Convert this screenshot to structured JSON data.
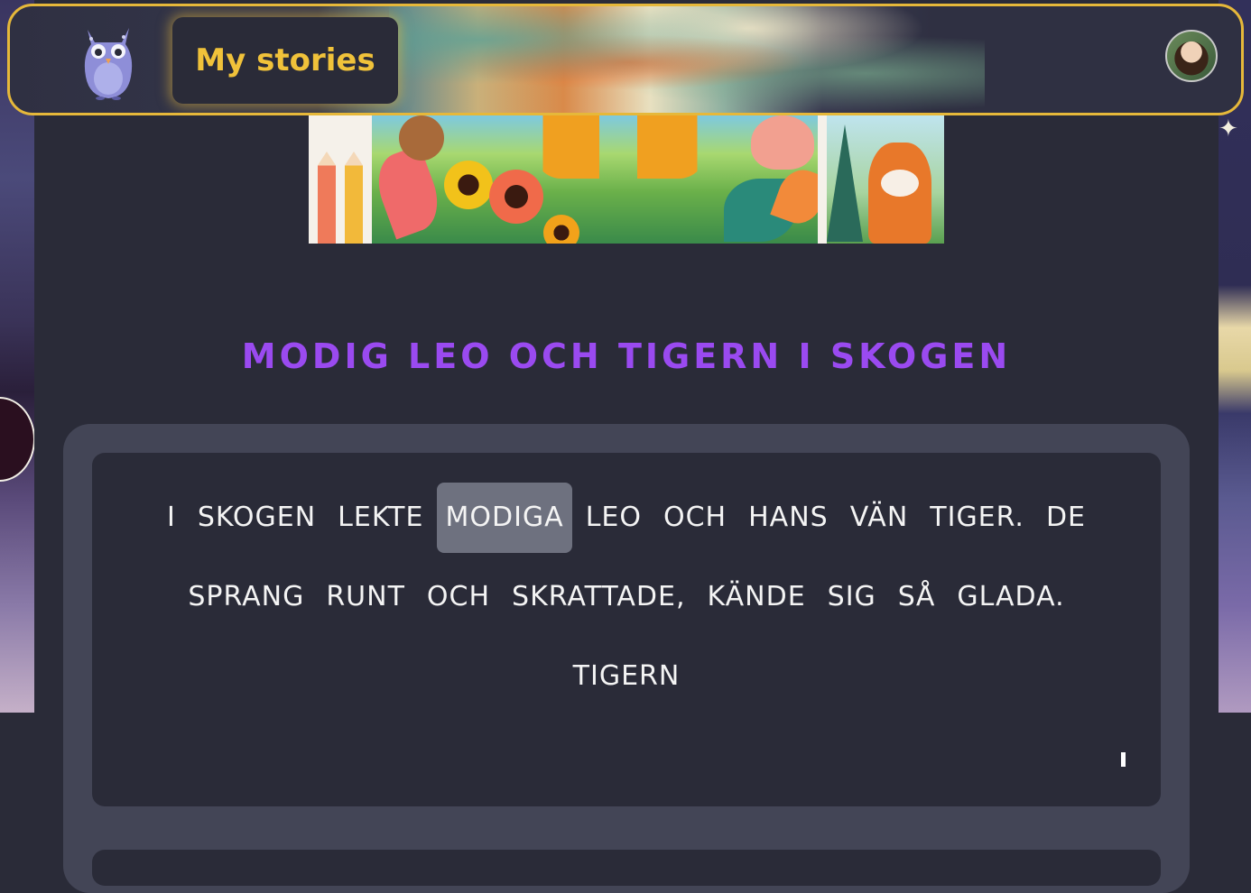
{
  "header": {
    "logo_name": "owl-logo",
    "nav_label": "My stories",
    "avatar_alt": "user-avatar"
  },
  "story": {
    "title": "MODIG LEO OCH TIGERN I SKOGEN",
    "lines": [
      [
        "I",
        "SKOGEN",
        "LEKTE",
        "MODIGA",
        "LEO",
        "OCH",
        "HANS",
        "VÄN",
        "TIGER.",
        "DE"
      ],
      [
        "SPRANG",
        "RUNT",
        "OCH",
        "SKRATTADE,",
        "KÄNDE",
        "SIG",
        "SÅ",
        "GLADA."
      ],
      [
        "TIGERN"
      ]
    ],
    "highlighted_word": "MODIGA"
  },
  "colors": {
    "accent_gold": "#e6b83a",
    "title_purple": "#9a4af0",
    "highlight": "#6e717f"
  }
}
